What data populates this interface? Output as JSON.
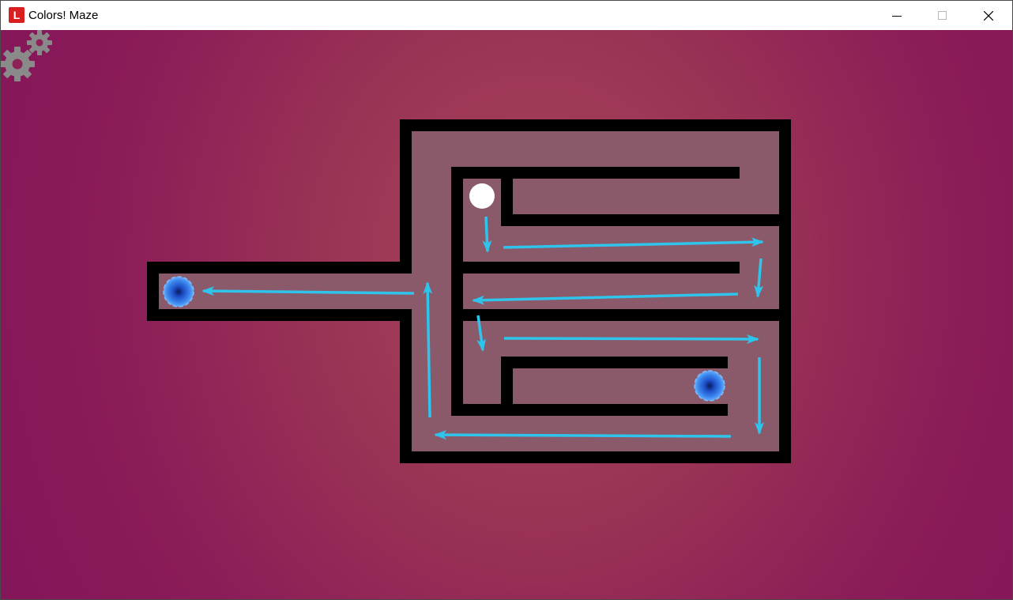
{
  "window": {
    "title": "Colors! Maze",
    "app_icon_glyph": "L",
    "controls": [
      "minimize-icon",
      "maximize-icon",
      "close-icon"
    ]
  },
  "game": {
    "toolbar_icon": "settings-gears-icon",
    "colors": {
      "background": "#8c1f58",
      "wall": "#000000",
      "floor": "#8a5a6a",
      "ball": "#ffffff",
      "arrow": "#2ec4ec",
      "portal": "#2b74e4"
    },
    "elements": [
      "player-ball",
      "portal",
      "path-arrow"
    ]
  }
}
